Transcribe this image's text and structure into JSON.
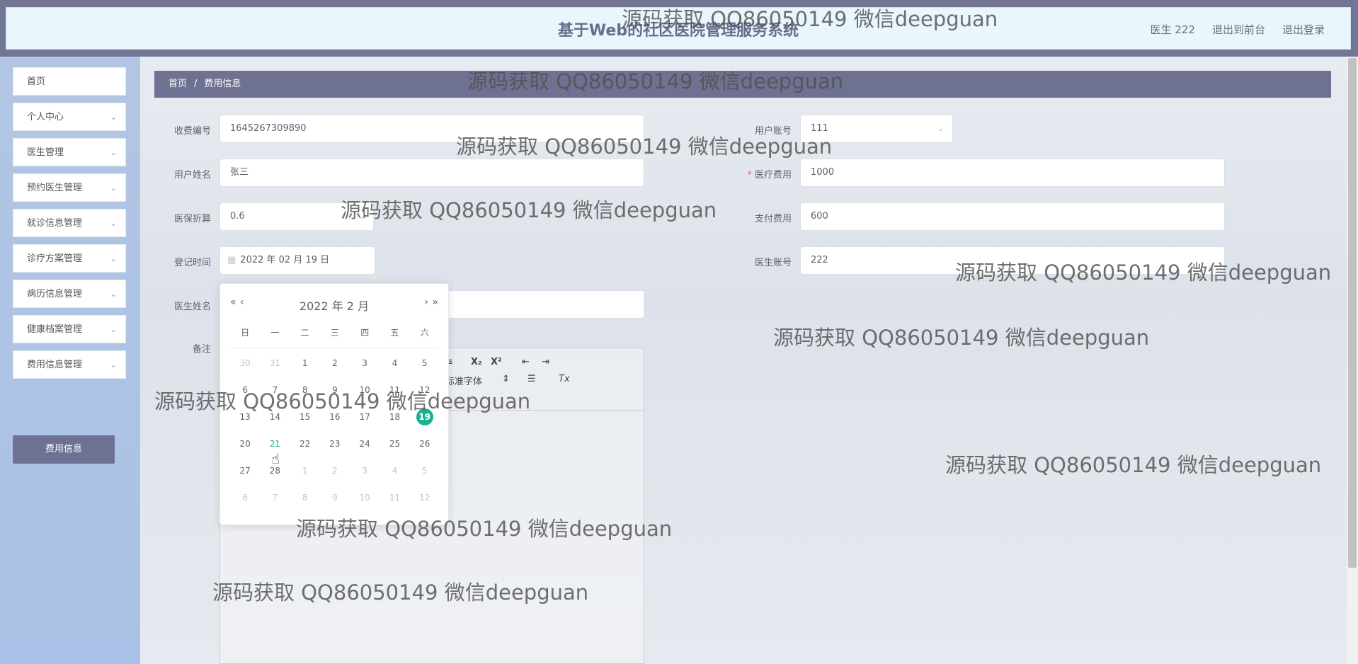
{
  "header": {
    "title": "基于Web的社区医院管理服务系统",
    "links": [
      "医生 222",
      "退出到前台",
      "退出登录"
    ]
  },
  "sidebar": {
    "items": [
      {
        "label": "首页",
        "has_arrow": false
      },
      {
        "label": "个人中心",
        "has_arrow": true
      },
      {
        "label": "医生管理",
        "has_arrow": true
      },
      {
        "label": "预约医生管理",
        "has_arrow": true
      },
      {
        "label": "就诊信息管理",
        "has_arrow": true
      },
      {
        "label": "诊疗方案管理",
        "has_arrow": true
      },
      {
        "label": "病历信息管理",
        "has_arrow": true
      },
      {
        "label": "健康档案管理",
        "has_arrow": true
      },
      {
        "label": "费用信息管理",
        "has_arrow": true
      }
    ],
    "submenu_active": "费用信息"
  },
  "breadcrumb": {
    "home": "首页",
    "sep": "/",
    "current": "费用信息"
  },
  "form": {
    "charge_no": {
      "label": "收费编号",
      "value": "1645267309890"
    },
    "user_account": {
      "label": "用户账号",
      "value": "111"
    },
    "user_name": {
      "label": "用户姓名",
      "value": "张三"
    },
    "medical_fee": {
      "label": "医疗费用",
      "value": "1000",
      "required": "*"
    },
    "insurance_discount": {
      "label": "医保折算",
      "value": "0.6"
    },
    "payment_fee": {
      "label": "支付费用",
      "value": "600"
    },
    "register_time": {
      "label": "登记时间",
      "value": "2022 年 02 月 19 日"
    },
    "doctor_account": {
      "label": "医生账号",
      "value": "222"
    },
    "doctor_name": {
      "label": "医生姓名",
      "value": ""
    },
    "remark": {
      "label": "备注"
    }
  },
  "editor": {
    "toolbar": [
      "≡",
      "X₂",
      "X²",
      "⇤",
      "⇥",
      "标准字体",
      "⇕",
      "☰",
      "Tx"
    ]
  },
  "datepicker": {
    "header": "2022 年  2 月",
    "prev_year": "«",
    "prev_month": "‹",
    "next_month": "›",
    "next_year": "»",
    "weekdays": [
      "日",
      "一",
      "二",
      "三",
      "四",
      "五",
      "六"
    ],
    "weeks": [
      [
        {
          "d": "30",
          "m": true
        },
        {
          "d": "31",
          "m": true
        },
        {
          "d": "1"
        },
        {
          "d": "2"
        },
        {
          "d": "3"
        },
        {
          "d": "4"
        },
        {
          "d": "5"
        }
      ],
      [
        {
          "d": "6"
        },
        {
          "d": "7"
        },
        {
          "d": "8"
        },
        {
          "d": "9"
        },
        {
          "d": "10"
        },
        {
          "d": "11"
        },
        {
          "d": "12"
        }
      ],
      [
        {
          "d": "13"
        },
        {
          "d": "14"
        },
        {
          "d": "15"
        },
        {
          "d": "16"
        },
        {
          "d": "17"
        },
        {
          "d": "18"
        },
        {
          "d": "19",
          "sel": true
        }
      ],
      [
        {
          "d": "20"
        },
        {
          "d": "21",
          "hover": true
        },
        {
          "d": "22"
        },
        {
          "d": "23"
        },
        {
          "d": "24"
        },
        {
          "d": "25"
        },
        {
          "d": "26"
        }
      ],
      [
        {
          "d": "27"
        },
        {
          "d": "28"
        },
        {
          "d": "1",
          "m": true
        },
        {
          "d": "2",
          "m": true
        },
        {
          "d": "3",
          "m": true
        },
        {
          "d": "4",
          "m": true
        },
        {
          "d": "5",
          "m": true
        }
      ],
      [
        {
          "d": "6",
          "m": true
        },
        {
          "d": "7",
          "m": true
        },
        {
          "d": "8",
          "m": true
        },
        {
          "d": "9",
          "m": true
        },
        {
          "d": "10",
          "m": true
        },
        {
          "d": "11",
          "m": true
        },
        {
          "d": "12",
          "m": true
        }
      ]
    ],
    "selected_color": "#18b393"
  },
  "watermark": "源码获取 QQ86050149 微信deepguan",
  "colors": {
    "accent": "#6f7192",
    "header_bg": "#e9f6fc",
    "sidebar_bg": "#b2c6e4"
  }
}
